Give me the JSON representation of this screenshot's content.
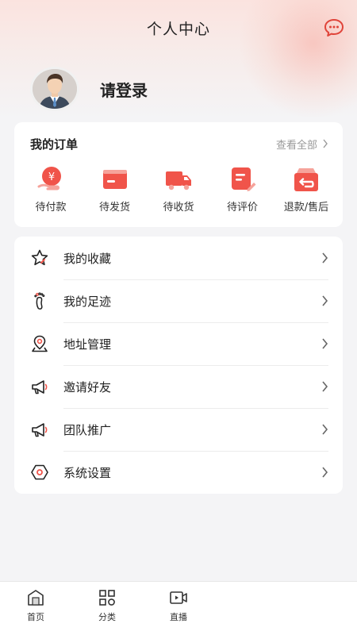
{
  "header": {
    "title": "个人中心",
    "message_icon": "chat-bubble-icon"
  },
  "profile": {
    "login_text": "请登录"
  },
  "orders": {
    "title": "我的订单",
    "view_all": "查看全部",
    "items": [
      {
        "label": "待付款",
        "icon": "yen-wallet-icon"
      },
      {
        "label": "待发货",
        "icon": "card-icon"
      },
      {
        "label": "待收货",
        "icon": "truck-icon"
      },
      {
        "label": "待评价",
        "icon": "review-pencil-icon"
      },
      {
        "label": "退款/售后",
        "icon": "refund-box-icon"
      }
    ]
  },
  "menu": {
    "items": [
      {
        "label": "我的收藏",
        "icon": "star-icon"
      },
      {
        "label": "我的足迹",
        "icon": "footprint-icon"
      },
      {
        "label": "地址管理",
        "icon": "location-pin-icon"
      },
      {
        "label": "邀请好友",
        "icon": "megaphone-icon"
      },
      {
        "label": "团队推广",
        "icon": "megaphone-icon"
      },
      {
        "label": "系统设置",
        "icon": "hexagon-settings-icon"
      }
    ]
  },
  "tabbar": {
    "items": [
      {
        "label": "首页",
        "icon": "home-icon"
      },
      {
        "label": "分类",
        "icon": "category-grid-icon"
      },
      {
        "label": "直播",
        "icon": "video-camera-icon"
      }
    ]
  },
  "colors": {
    "accent": "#f0544a",
    "text": "#222222",
    "muted": "#999999",
    "background": "#f4f4f6"
  }
}
